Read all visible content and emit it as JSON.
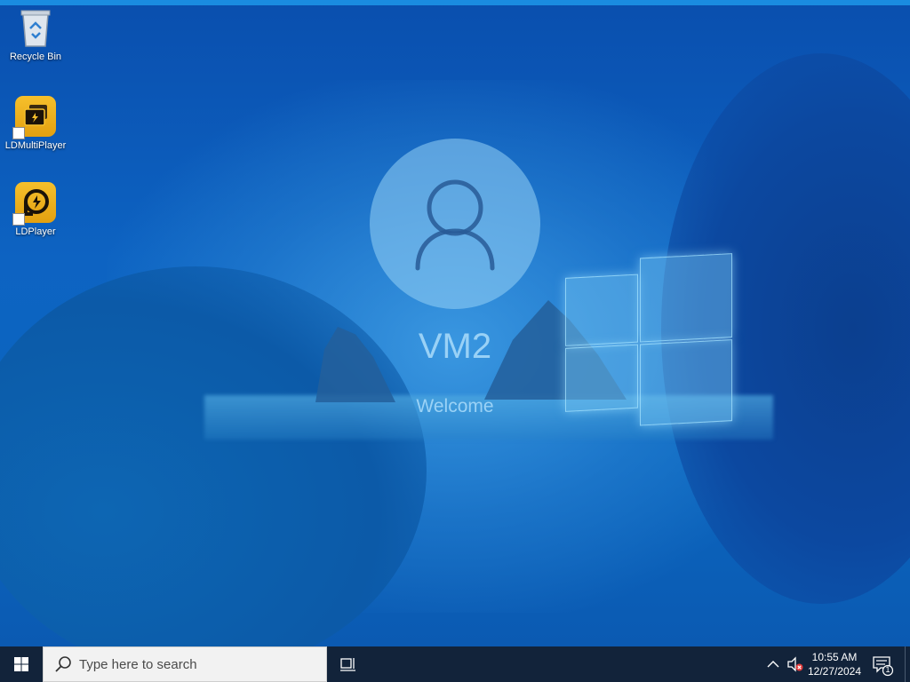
{
  "desktop": {
    "icons": [
      {
        "label": "Recycle Bin",
        "icon": "recycle-bin-icon"
      },
      {
        "label": "LDMultiPlayer",
        "icon": "ldmultiplayer-icon"
      },
      {
        "label": "LDPlayer",
        "icon": "ldplayer-icon"
      }
    ]
  },
  "lockscreen": {
    "username": "VM2",
    "status": "Welcome",
    "avatar_icon": "user-avatar-icon"
  },
  "taskbar": {
    "start_icon": "windows-start-icon",
    "search_placeholder": "Type here to search",
    "search_icon": "search-icon",
    "taskview_icon": "task-view-icon",
    "tray_icons": [
      "show-hidden-icons-icon",
      "volume-muted-icon"
    ],
    "time": "10:55 AM",
    "date": "12/27/2024",
    "notification_icon": "notification-center-icon",
    "notification_count": "1"
  },
  "colors": {
    "taskbar_bg": "#12233a",
    "wallpaper_blue": "#0d63c2",
    "app_yellow": "#f6c02c"
  }
}
